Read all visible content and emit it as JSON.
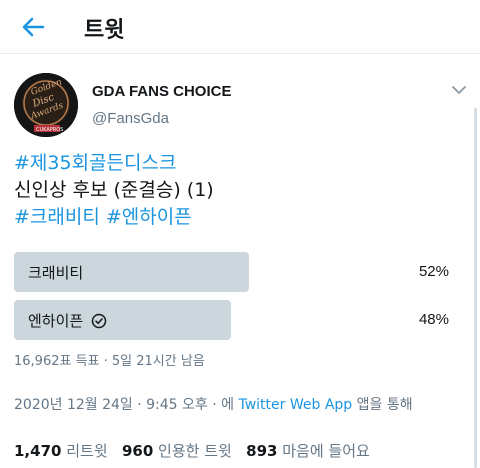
{
  "header": {
    "title": "트윗",
    "back_icon": "back-arrow-icon"
  },
  "author": {
    "display_name": "GDA FANS CHOICE",
    "handle": "@FansGda",
    "avatar_text_1": "Golden",
    "avatar_text_2": "Disc",
    "avatar_text_3": "Awards",
    "avatar_text_4": "CUKAPROS"
  },
  "tweet": {
    "hashtag1": "#제35회골든디스크",
    "line2": "신인상 후보 (준결승) (1)",
    "hashtag2": "#크래비티",
    "hashtag3": "#엔하이픈"
  },
  "poll": {
    "options": [
      {
        "label": "크래비티",
        "percent": "52%",
        "fill": 0.52,
        "winner": false
      },
      {
        "label": "엔하이픈",
        "percent": "48%",
        "fill": 0.48,
        "winner": true
      }
    ],
    "meta": "16,962표 득표 · 5일 21시간 남음"
  },
  "timestamp": {
    "prefix": "2020년 12월 24일 · 9:45 오후 · 에 ",
    "source": "Twitter Web App",
    "suffix": " 앱을 통해"
  },
  "stats": {
    "retweets_count": "1,470",
    "retweets_label": "리트윗",
    "quotes_count": "960",
    "quotes_label": "인용한 트윗",
    "likes_count": "893",
    "likes_label": "마음에 들어요"
  },
  "colors": {
    "accent": "#1b95e0",
    "poll_bar": "#ccd6dd",
    "secondary_text": "#657786"
  }
}
